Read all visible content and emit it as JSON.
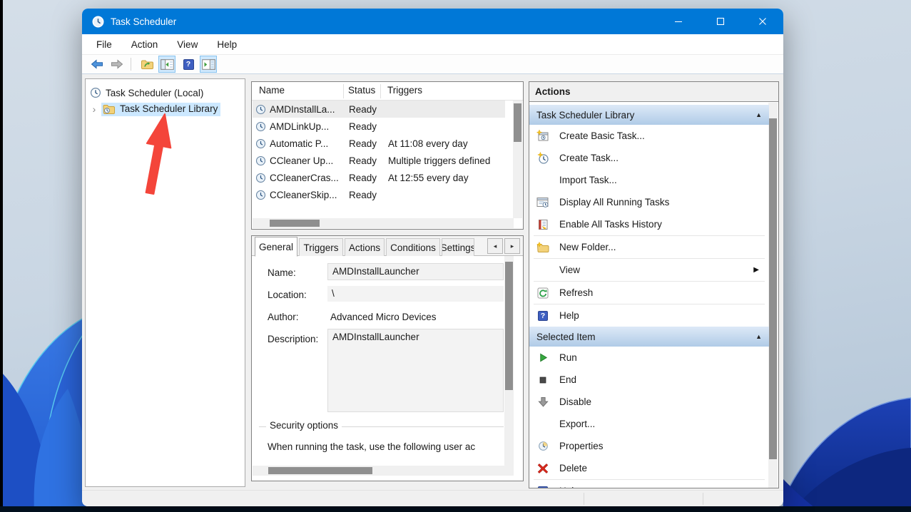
{
  "window": {
    "title": "Task Scheduler"
  },
  "menu": {
    "items": [
      "File",
      "Action",
      "View",
      "Help"
    ]
  },
  "tree": {
    "items": [
      {
        "label": "Task Scheduler (Local)"
      },
      {
        "label": "Task Scheduler Library",
        "selected": true
      }
    ]
  },
  "task_list": {
    "columns": [
      "Name",
      "Status",
      "Triggers"
    ],
    "rows": [
      {
        "name": "AMDInstallLa...",
        "status": "Ready",
        "triggers": "",
        "selected": true
      },
      {
        "name": "AMDLinkUp...",
        "status": "Ready",
        "triggers": ""
      },
      {
        "name": "Automatic P...",
        "status": "Ready",
        "triggers": "At 11:08 every day"
      },
      {
        "name": "CCleaner Up...",
        "status": "Ready",
        "triggers": "Multiple triggers defined"
      },
      {
        "name": "CCleanerCras...",
        "status": "Ready",
        "triggers": "At 12:55 every day"
      },
      {
        "name": "CCleanerSkip...",
        "status": "Ready",
        "triggers": ""
      }
    ]
  },
  "detail": {
    "tabs": [
      "General",
      "Triggers",
      "Actions",
      "Conditions",
      "Settings"
    ],
    "fields": {
      "name_label": "Name:",
      "name_value": "AMDInstallLauncher",
      "location_label": "Location:",
      "location_value": "\\",
      "author_label": "Author:",
      "author_value": "Advanced Micro Devices",
      "description_label": "Description:",
      "description_value": "AMDInstallLauncher"
    },
    "security": {
      "title": "Security options",
      "text": "When running the task, use the following user ac"
    }
  },
  "actions": {
    "title": "Actions",
    "library_header": "Task Scheduler Library",
    "library_items": [
      "Create Basic Task...",
      "Create Task...",
      "Import Task...",
      "Display All Running Tasks",
      "Enable All Tasks History",
      "New Folder...",
      "View",
      "Refresh",
      "Help"
    ],
    "selected_header": "Selected Item",
    "selected_items": [
      "Run",
      "End",
      "Disable",
      "Export...",
      "Properties",
      "Delete",
      "Help"
    ]
  },
  "glyphs": {
    "collapse": "▲",
    "flyout": "▶",
    "tab_prev": "◂",
    "tab_next": "▸",
    "question": "?",
    "tree_expand": "›"
  },
  "colors": {
    "titlebar": "#0078d7",
    "tree_selection": "#cce8ff",
    "section_header_top": "#dde9f7",
    "section_header_bottom": "#b0cbe7",
    "annotation_arrow": "#f4453a"
  }
}
